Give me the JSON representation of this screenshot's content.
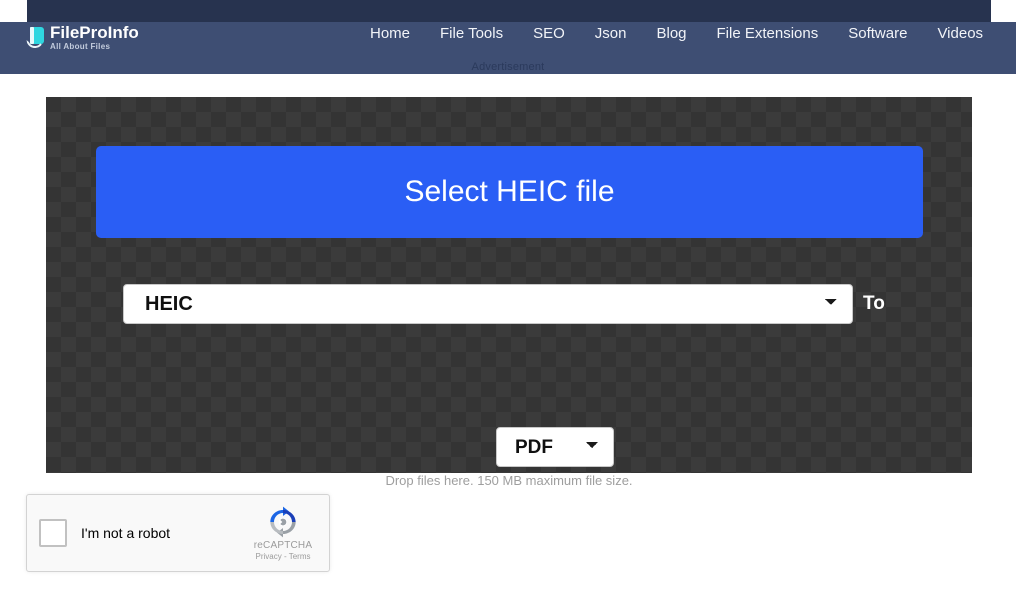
{
  "header": {
    "logo": {
      "title": "FileProInfo",
      "tagline": "All About Files",
      "icon": "file-pro-info-logo-icon",
      "accent_color": "#2fd6e0"
    },
    "nav_items": [
      {
        "label": "Home"
      },
      {
        "label": "File Tools"
      },
      {
        "label": "SEO"
      },
      {
        "label": "Json"
      },
      {
        "label": "Blog"
      },
      {
        "label": "File Extensions"
      },
      {
        "label": "Software"
      },
      {
        "label": "Videos"
      }
    ],
    "advertisement_label": "Advertisement",
    "band_color": "#27334f",
    "bar_color": "#3e4e73"
  },
  "converter": {
    "select_file_button_label": "Select HEIC file",
    "select_file_button_color": "#2a5ef5",
    "source_format": {
      "value": "HEIC",
      "options": [
        "HEIC"
      ]
    },
    "to_label": "To",
    "target_format": {
      "value": "PDF",
      "options": [
        "PDF"
      ]
    },
    "drop_hint": "Drop files here. 150 MB maximum file size."
  },
  "recaptcha": {
    "checkbox_label": "I'm not a robot",
    "brand_name": "reCAPTCHA",
    "legal": "Privacy - Terms",
    "checked": false,
    "logo_icon": "recaptcha-logo-icon"
  }
}
